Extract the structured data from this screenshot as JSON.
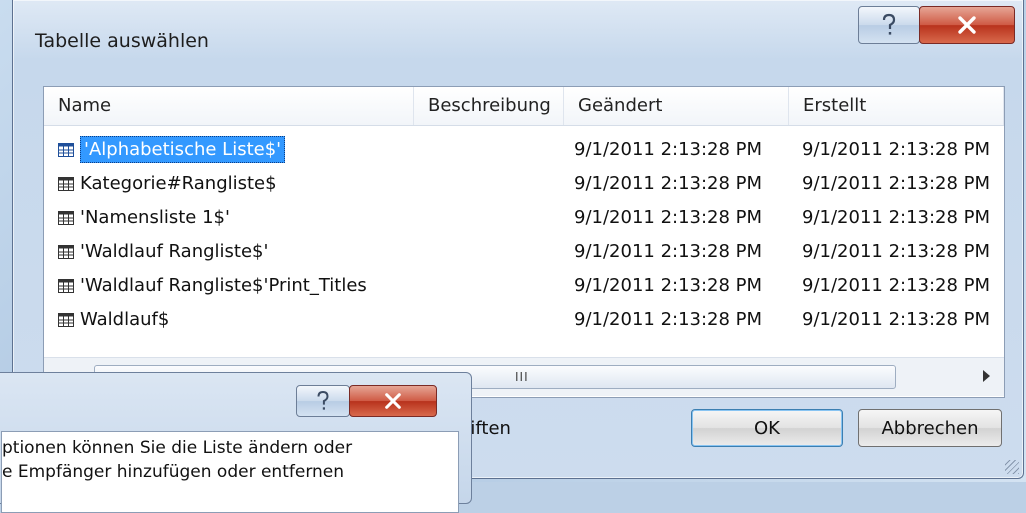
{
  "dialog": {
    "title": "Tabelle auswählen",
    "help_glyph": "?",
    "close_glyph": "X"
  },
  "columns": [
    "Name",
    "Beschreibung",
    "Geändert",
    "Erstellt"
  ],
  "rows": [
    {
      "name": "'Alphabetische Liste$'",
      "description": "",
      "modified": "9/1/2011 2:13:28 PM",
      "created": "9/1/2011 2:13:28 PM",
      "selected": true
    },
    {
      "name": "Kategorie#Rangliste$",
      "description": "",
      "modified": "9/1/2011 2:13:28 PM",
      "created": "9/1/2011 2:13:28 PM",
      "selected": false
    },
    {
      "name": "'Namensliste 1$'",
      "description": "",
      "modified": "9/1/2011 2:13:28 PM",
      "created": "9/1/2011 2:13:28 PM",
      "selected": false
    },
    {
      "name": "'Waldlauf Rangliste$'",
      "description": "",
      "modified": "9/1/2011 2:13:28 PM",
      "created": "9/1/2011 2:13:28 PM",
      "selected": false
    },
    {
      "name": "'Waldlauf Rangliste$'Print_Titles",
      "description": "",
      "modified": "9/1/2011 2:13:28 PM",
      "created": "9/1/2011 2:13:28 PM",
      "selected": false
    },
    {
      "name": "Waldlauf$",
      "description": "",
      "modified": "9/1/2011 2:13:28 PM",
      "created": "9/1/2011 2:13:28 PM",
      "selected": false
    }
  ],
  "scrollbar": {
    "grip": "III"
  },
  "first_row_partial_label": "riften",
  "buttons": {
    "ok": "OK",
    "cancel": "Abbrechen"
  },
  "background_dialog": {
    "line1": "ptionen können Sie die Liste ändern oder",
    "line2": "e Empfänger hinzufügen oder entfernen"
  },
  "colors": {
    "selection": "#3399ff",
    "close_button": "#c8432c",
    "dialog_bg": "#d3e1f0"
  }
}
